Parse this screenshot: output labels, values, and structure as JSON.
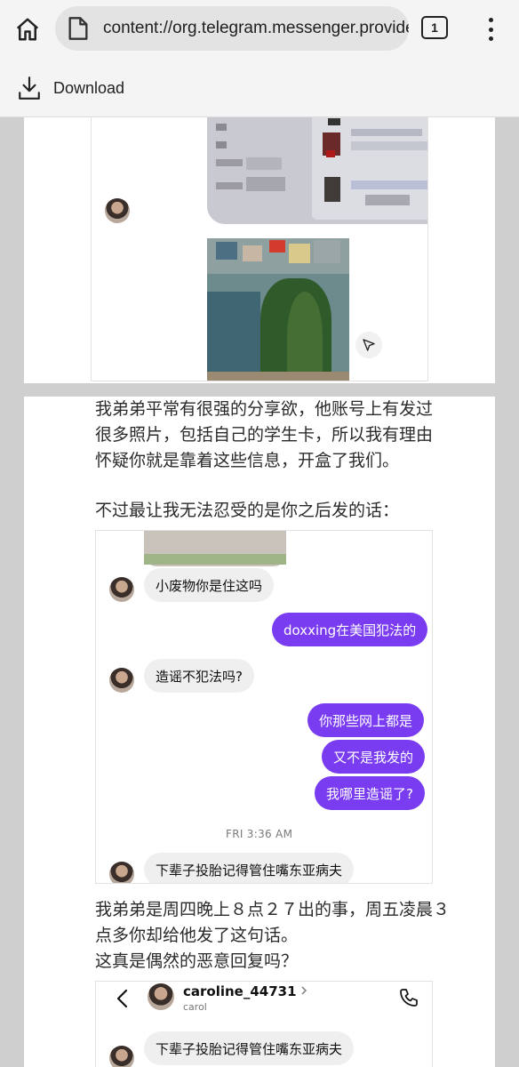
{
  "browser": {
    "url": "content://org.telegram.messenger.provider/",
    "tab_count": "1",
    "download_label": "Download"
  },
  "document": {
    "paragraph1": [
      "我弟弟平常有很强的分享欲，他账号上有发过",
      "很多照片，包括自己的学生卡，所以我有理由",
      "怀疑你就是靠着这些信息，开盒了我们。"
    ],
    "paragraph2": "不过最让我无法忍受的是你之后发的话：",
    "paragraph3": [
      "我弟弟是周四晚上８点２７出的事，周五凌晨３",
      "点多你却给他发了这句话。",
      "这真是偶然的恶意回复吗？"
    ]
  },
  "chat1": {
    "messages": [
      {
        "dir": "in",
        "text": "小废物你是住这吗"
      },
      {
        "dir": "out",
        "text": "doxxing在美国犯法的"
      },
      {
        "dir": "in",
        "text": "造谣不犯法吗?"
      },
      {
        "dir": "out",
        "text": "你那些网上都是"
      },
      {
        "dir": "out",
        "text": "又不是我发的"
      },
      {
        "dir": "out",
        "text": "我哪里造谣了?"
      }
    ],
    "timestamp": "FRI 3:36 AM",
    "last_message": "下辈子投胎记得管住嘴东亚病夫"
  },
  "chat2": {
    "username": "caroline_44731",
    "display_name": "carol",
    "message": "下辈子投胎记得管住嘴东亚病夫"
  },
  "colors": {
    "accent_purple": "#7a3cf0",
    "incoming_bubble": "#efefef",
    "chrome_bg": "#f4f4f4",
    "gutter": "#cfcfcf"
  }
}
